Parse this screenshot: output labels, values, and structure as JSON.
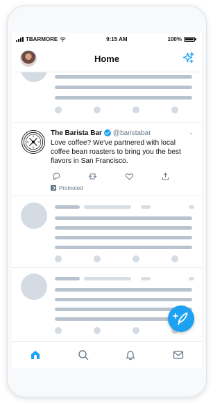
{
  "status_bar": {
    "carrier": "TBARMORE",
    "time": "9:15 AM",
    "battery": "100%"
  },
  "header": {
    "title": "Home"
  },
  "tweet": {
    "display_name": "The Barista Bar",
    "handle": "@baristabar",
    "text": "Love coffee? We've partnered with local coffee bean roasters to bring you the best flavors in San Francisco.",
    "promoted_label": "Promoted"
  },
  "icons": {
    "menu_avatar": "avatar",
    "top_right": "sparkle-icon",
    "reply": "reply-icon",
    "retweet": "retweet-icon",
    "like": "heart-icon",
    "share": "share-icon",
    "compose": "compose-icon",
    "home": "home-icon",
    "search": "search-icon",
    "notifications": "bell-icon",
    "messages": "mail-icon"
  },
  "colors": {
    "brand_blue": "#1da1f2",
    "skeleton_dark": "#b8c3cd",
    "skeleton_light": "#d8dee4",
    "muted_text": "#657786"
  }
}
